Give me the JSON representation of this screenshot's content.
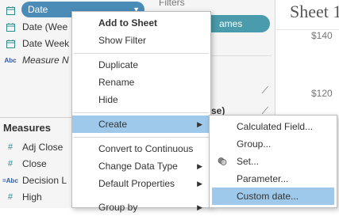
{
  "data_pane": {
    "dimensions": [
      {
        "label": "Date",
        "icon": "calendar-icon"
      },
      {
        "label": "Date (Wee",
        "icon": "calendar-icon"
      },
      {
        "label": "Date Week",
        "icon": "calendar-icon"
      },
      {
        "label": "Measure N",
        "icon": "abc-icon"
      }
    ],
    "measures_header": "Measures",
    "measures": [
      {
        "label": "Adj Close",
        "icon": "hash-icon"
      },
      {
        "label": "Close",
        "icon": "hash-icon"
      },
      {
        "label": "Decision L",
        "icon": "abc-hash-icon"
      },
      {
        "label": "High",
        "icon": "hash-icon"
      }
    ]
  },
  "shelves": {
    "filters_label": "Filters",
    "names_pill": "ames",
    "partial_label": "se)"
  },
  "sheet": {
    "title": "Sheet 1",
    "y_ticks": [
      "$140",
      "$120"
    ]
  },
  "context_menu": {
    "items": [
      {
        "label": "Add to Sheet",
        "bold": true
      },
      {
        "label": "Show Filter"
      },
      {
        "label": "Duplicate"
      },
      {
        "label": "Rename"
      },
      {
        "label": "Hide"
      },
      {
        "label": "Create",
        "submenu": true,
        "active": true
      },
      {
        "label": "Convert to Continuous"
      },
      {
        "label": "Change Data Type",
        "submenu": true
      },
      {
        "label": "Default Properties",
        "submenu": true
      },
      {
        "label": "Group by",
        "submenu": true
      }
    ]
  },
  "submenu": {
    "items": [
      {
        "label": "Calculated Field..."
      },
      {
        "label": "Group..."
      },
      {
        "label": "Set..."
      },
      {
        "label": "Parameter..."
      },
      {
        "label": "Custom date...",
        "active": true
      }
    ]
  },
  "colors": {
    "pill": "#4a8bb8",
    "highlight": "#9ec9eb",
    "dimension_icon": "#2f8c8c"
  }
}
